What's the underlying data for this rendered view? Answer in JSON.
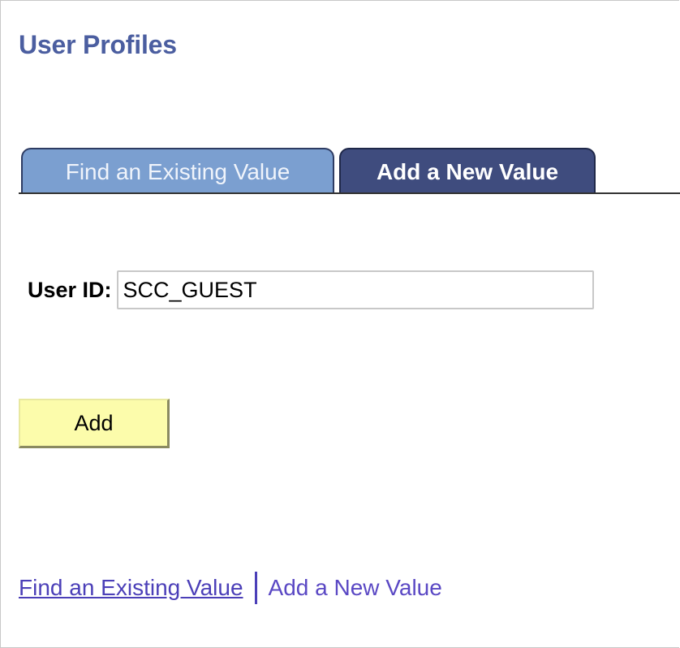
{
  "page": {
    "title": "User Profiles"
  },
  "tabs": {
    "find_label": "Find an Existing Value",
    "add_label": "Add a New Value",
    "active": "add"
  },
  "form": {
    "user_id_label": "User ID:",
    "user_id_value": "SCC_GUEST"
  },
  "actions": {
    "add_label": "Add"
  },
  "footer_links": {
    "find_label": "Find an Existing Value",
    "add_label": "Add a New Value"
  },
  "colors": {
    "title": "#4b5ea0",
    "tab_inactive": "#7b9fd0",
    "tab_active": "#3f4c7e",
    "button_bg": "#fcfcab",
    "link": "#4b3fb8"
  }
}
